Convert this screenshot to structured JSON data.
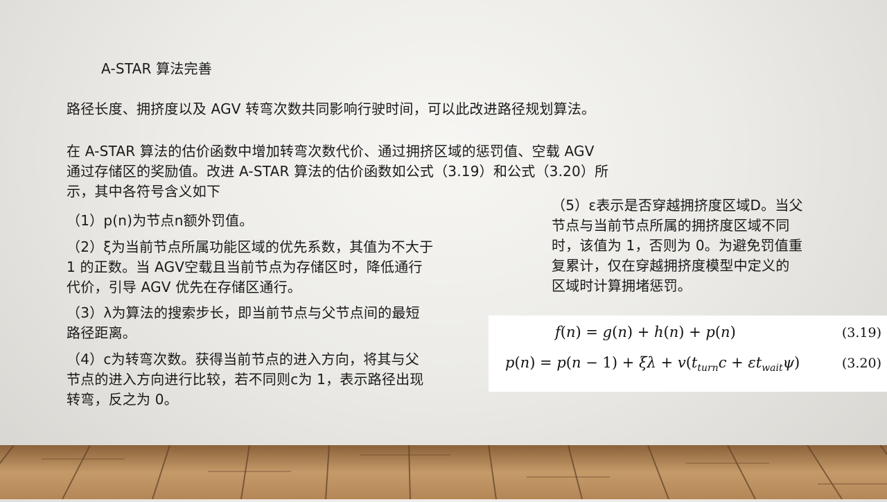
{
  "slide": {
    "title": "A-STAR 算法完善",
    "line1": "路径长度、拥挤度以及 AGV 转弯次数共同影响行驶时间，可以此改进路径规划算法。",
    "para2": [
      "在 A-STAR 算法的估价函数中增加转弯次数代价、通过拥挤区域的惩罚值、空载 AGV",
      "通过存储区的奖励值。改进 A-STAR 算法的估价函数如公式（3.19）和公式（3.20）所",
      "示，其中各符号含义如下"
    ],
    "item1": [
      "（1）p(n)为节点n额外罚值。"
    ],
    "item2": [
      "（2）ξ为当前节点所属功能区域的优先系数，其值为不大于",
      "1 的正数。当 AGV空载且当前节点为存储区时，降低通行",
      "代价，引导 AGV 优先在存储区通行。"
    ],
    "item3": [
      "（3）λ为算法的搜索步长，即当前节点与父节点间的最短",
      "路径距离。"
    ],
    "item4": [
      "（4）c为转弯次数。获得当前节点的进入方向，将其与父",
      "节点的进入方向进行比较，若不同则c为 1，表示路径出现",
      "转弯，反之为 0。"
    ],
    "item5": [
      "（5）ε表示是否穿越拥挤度区域D。当父",
      "节点与当前节点所属的拥挤度区域不同",
      "时，该值为 1，否则为 0。为避免罚值重",
      "复累计，仅在穿越拥挤度模型中定义的",
      "区域时计算拥堵惩罚。"
    ]
  },
  "formulas": [
    {
      "number": "(3.19)"
    },
    {
      "number": "(3.20)"
    }
  ],
  "colors": {
    "background": "#ecebe7",
    "text": "#1a1a1a",
    "floor": "#b98f5f"
  }
}
